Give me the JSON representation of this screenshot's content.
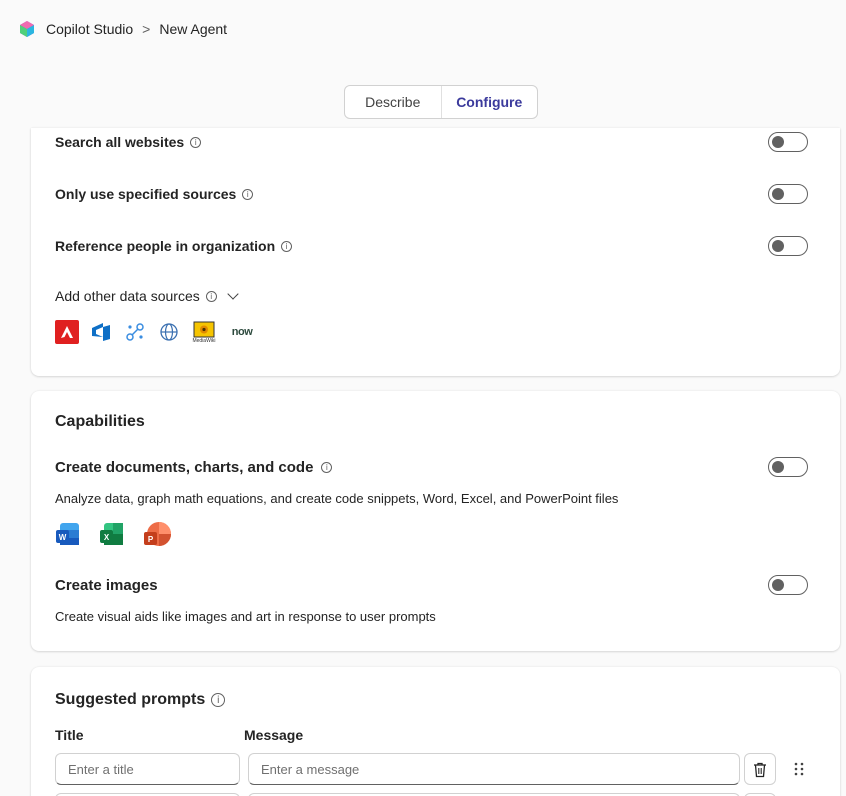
{
  "header": {
    "app_name": "Copilot Studio",
    "separator": ">",
    "agent_name": "New Agent"
  },
  "tabs": [
    {
      "label": "Describe",
      "active": false
    },
    {
      "label": "Configure",
      "active": true
    }
  ],
  "knowledge": {
    "rows": [
      {
        "label": "Search all websites",
        "enabled": false
      },
      {
        "label": "Only use specified sources",
        "enabled": false
      },
      {
        "label": "Reference people in organization",
        "enabled": false
      }
    ],
    "add_sources_label": "Add other data sources",
    "source_icons": [
      "adobe-icon",
      "azure-devops-icon",
      "connector-icon",
      "globe-icon",
      "mediawiki-icon",
      "servicenow-icon"
    ],
    "servicenow_text": "now",
    "mediawiki_text": "MediaWiki"
  },
  "capabilities": {
    "title": "Capabilities",
    "items": [
      {
        "title": "Create documents, charts, and code",
        "description": "Analyze data, graph math equations, and create code snippets, Word, Excel, and PowerPoint files",
        "enabled": false
      },
      {
        "title": "Create images",
        "description": "Create visual aids like images and art in response to user prompts",
        "enabled": false
      }
    ],
    "office_icons": [
      "word-icon",
      "excel-icon",
      "powerpoint-icon"
    ],
    "office_letters": {
      "word": "W",
      "excel": "X",
      "powerpoint": "P"
    }
  },
  "prompts": {
    "title": "Suggested prompts",
    "col_title": "Title",
    "col_message": "Message",
    "title_placeholder": "Enter a title",
    "message_placeholder": "Enter a message"
  },
  "colors": {
    "accent": "#3b3a9c",
    "toggle_off": "#616161"
  }
}
